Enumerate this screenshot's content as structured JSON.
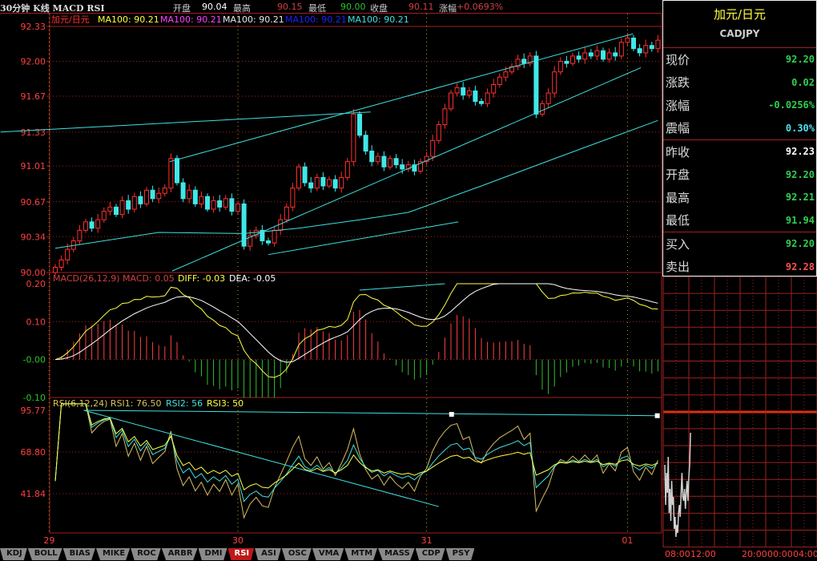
{
  "header": {
    "title": "30分钟 K线 MACD RSI",
    "open_label": "开盘",
    "open": "90.04",
    "high_label": "最高",
    "high": "90.15",
    "low_label": "最低",
    "low": "90.00",
    "close_label": "收盘",
    "close": "90.11",
    "change_label": "涨幅",
    "change": "+0.0693%"
  },
  "main_legend": {
    "name": "加元/日元",
    "ma": [
      {
        "text": "MA100: 90.21",
        "color": "#ffff40"
      },
      {
        "text": "MA100: 90.21",
        "color": "#ff40ff"
      },
      {
        "text": "MA100: 90.21",
        "color": "#e8e8e8"
      },
      {
        "text": "MA100: 90.21",
        "color": "#2020ff"
      },
      {
        "text": "MA100: 90.21",
        "color": "#40e0e0"
      }
    ]
  },
  "macd_legend": {
    "params": "MACD(26,12,9) MACD: 0.05",
    "diff": "DIFF: -0.03",
    "dea": "DEA: -0.05"
  },
  "rsi_legend": {
    "params": "RSI(6,12,24) RSI1: 76.50",
    "rsi2": "RSI2: 56",
    "rsi3": "RSI3: 50"
  },
  "colors": {
    "up": "#ff3030",
    "down": "#40e8e8",
    "grid": "#a02020",
    "axis": "#ff4040",
    "trend": "#40e0e0"
  },
  "chart_data": {
    "type": "candlestick",
    "price_axis": {
      "ticks": [
        "92.33",
        "92.00",
        "91.67",
        "91.33",
        "91.01",
        "90.67",
        "90.34",
        "90.00"
      ],
      "range": [
        90.0,
        92.33
      ]
    },
    "macd_axis": {
      "ticks": [
        "0.20",
        "0.10",
        "-0.00",
        "-0.10"
      ],
      "range": [
        -0.1,
        0.2
      ]
    },
    "rsi_axis": {
      "ticks": [
        "95.77",
        "68.80",
        "41.84"
      ],
      "range": [
        16.4,
        100
      ]
    },
    "x_labels": [
      {
        "text": "29",
        "index": -1
      },
      {
        "text": "30",
        "index": 30
      },
      {
        "text": "31",
        "index": 61
      },
      {
        "text": "01",
        "index": 94
      }
    ],
    "first_open": 90.0,
    "closes": [
      90.05,
      90.12,
      90.22,
      90.3,
      90.4,
      90.48,
      90.42,
      90.5,
      90.58,
      90.62,
      90.55,
      90.68,
      90.6,
      90.72,
      90.65,
      90.78,
      90.7,
      90.75,
      90.8,
      91.08,
      90.85,
      90.7,
      90.78,
      90.65,
      90.72,
      90.6,
      90.68,
      90.62,
      90.7,
      90.58,
      90.65,
      90.25,
      90.35,
      90.4,
      90.3,
      90.28,
      90.4,
      90.5,
      90.62,
      90.8,
      91.0,
      90.85,
      90.8,
      90.9,
      90.82,
      90.88,
      90.8,
      90.9,
      91.05,
      91.5,
      91.3,
      91.15,
      91.05,
      91.1,
      91.0,
      91.08,
      91.02,
      90.98,
      91.02,
      90.96,
      91.05,
      91.1,
      91.25,
      91.4,
      91.55,
      91.7,
      91.75,
      91.68,
      91.72,
      91.62,
      91.6,
      91.7,
      91.78,
      91.85,
      91.9,
      91.95,
      92.02,
      91.98,
      92.05,
      91.5,
      91.6,
      91.7,
      91.9,
      92.0,
      91.98,
      92.05,
      92.02,
      92.08,
      92.05,
      92.1,
      92.02,
      92.08,
      92.05,
      92.18,
      92.22,
      92.12,
      92.08,
      92.15,
      92.12,
      92.2
    ],
    "ma_line": [
      [
        0,
        90.23
      ],
      [
        17,
        90.38
      ],
      [
        31,
        90.37
      ],
      [
        40,
        90.42
      ],
      [
        50,
        90.5
      ],
      [
        58,
        90.57
      ],
      [
        70,
        90.82
      ],
      [
        83,
        91.1
      ],
      [
        99,
        91.44
      ]
    ],
    "price_trendlines": [
      [
        [
          -9,
          91.33
        ],
        [
          51.8,
          91.52
        ]
      ],
      [
        [
          18.8,
          91.05
        ],
        [
          94.9,
          92.26
        ]
      ],
      [
        [
          19.2,
          90.015
        ],
        [
          96.2,
          91.94
        ]
      ],
      [
        [
          35,
          90.17
        ],
        [
          66.2,
          90.48
        ]
      ]
    ],
    "macd_trendlines": [
      [
        [
          50,
          0.183
        ],
        [
          64,
          0.2
        ]
      ]
    ],
    "rsi_trendlines": [
      [
        [
          4.7,
          95.77
        ],
        [
          98.9,
          92.3
        ]
      ],
      [
        [
          4.7,
          95.77
        ],
        [
          63,
          33.5
        ]
      ]
    ],
    "rsi_markers": [
      [
        65.1,
        93.2
      ],
      [
        98.9,
        92.3
      ]
    ]
  },
  "quote": {
    "name": "加元/日元",
    "code": "CADJPY",
    "groups": [
      [
        {
          "label": "现价",
          "value": "92.20",
          "color": "#30d050"
        },
        {
          "label": "涨跌",
          "value": "0.02",
          "color": "#30d050"
        },
        {
          "label": "涨幅",
          "value": "-0.0256%",
          "color": "#30d050"
        },
        {
          "label": "震幅",
          "value": "0.30%",
          "color": "#50e0f0"
        }
      ],
      [
        {
          "label": "昨收",
          "value": "92.23",
          "color": "#ffffff"
        },
        {
          "label": "开盘",
          "value": "92.20",
          "color": "#30d050"
        },
        {
          "label": "最高",
          "value": "92.21",
          "color": "#30d050"
        },
        {
          "label": "最低",
          "value": "91.94",
          "color": "#30d050"
        }
      ],
      [
        {
          "label": "买入",
          "value": "92.20",
          "color": "#30d050"
        },
        {
          "label": "卖出",
          "value": "92.28",
          "color": "#ff5050"
        }
      ]
    ]
  },
  "intraday": {
    "time_labels": [
      "08:00",
      "12:00",
      "20:00",
      "00:00",
      "04:00"
    ],
    "values": [
      92.12,
      92.02,
      92.1,
      92.05,
      92.14,
      92.0,
      92.06,
      91.98,
      92.08,
      92.02,
      92.04,
      91.96,
      91.99,
      91.94,
      91.97,
      91.95,
      92.0,
      92.02,
      91.99,
      92.05,
      92.1,
      92.04,
      92.03,
      92.06,
      92.01,
      92.05,
      92.08,
      92.03,
      92.09,
      92.12,
      92.2
    ]
  },
  "tabs": [
    "KDJ",
    "BOLL",
    "BIAS",
    "MIKE",
    "ROC",
    "ARBR",
    "DMI",
    "RSI",
    "ASI",
    "OSC",
    "VMA",
    "MTM",
    "MASS",
    "CDP",
    "PSY"
  ],
  "active_tab": "RSI"
}
